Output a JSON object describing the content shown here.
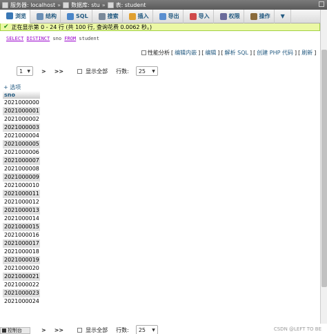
{
  "topbar": {
    "server": "服务器: localhost",
    "database": "数据库: stu",
    "table": "表: student"
  },
  "tabs": [
    {
      "label": "浏览",
      "icon": "browse-icon",
      "color": "#3a78b6"
    },
    {
      "label": "结构",
      "icon": "structure-icon",
      "color": "#6a8fb5"
    },
    {
      "label": "SQL",
      "icon": "sql-icon",
      "color": "#4a86c8"
    },
    {
      "label": "搜索",
      "icon": "search-icon",
      "color": "#7b8a9a"
    },
    {
      "label": "插入",
      "icon": "insert-icon",
      "color": "#e0a030"
    },
    {
      "label": "导出",
      "icon": "export-icon",
      "color": "#5b8fd0"
    },
    {
      "label": "导入",
      "icon": "import-icon",
      "color": "#d04a4a"
    },
    {
      "label": "权限",
      "icon": "privileges-icon",
      "color": "#6a6a9a"
    },
    {
      "label": "操作",
      "icon": "operations-icon",
      "color": "#8a6a3a"
    }
  ],
  "status": {
    "message": "正在显示第 0 - 24 行 (共 100 行, 查询花费 0.0062 秒。)"
  },
  "query": {
    "select": "SELECT",
    "distinct": "DISTINCT",
    "column": "sno",
    "from": "FROM",
    "table": "student"
  },
  "links": {
    "profiling": "性能分析",
    "inline_edit": "编辑内嵌",
    "edit": "编辑",
    "explain": "解析 SQL",
    "create_php": "创建 PHP 代码",
    "refresh": "刷新"
  },
  "pager": {
    "page": "1",
    "next": ">",
    "last": ">>",
    "show_all": "显示全部",
    "rows_label": "行数:",
    "rows": "25"
  },
  "options_label": "+ 选项",
  "table": {
    "header": "sno",
    "rows": [
      "2021000000",
      "2021000001",
      "2021000002",
      "2021000003",
      "2021000004",
      "2021000005",
      "2021000006",
      "2021000007",
      "2021000008",
      "2021000009",
      "2021000010",
      "2021000011",
      "2021000012",
      "2021000013",
      "2021000014",
      "2021000015",
      "2021000016",
      "2021000017",
      "2021000018",
      "2021000019",
      "2021000020",
      "2021000021",
      "2021000022",
      "2021000023",
      "2021000024"
    ]
  },
  "console": {
    "label": "控制台"
  },
  "watermark": "CSDN @LEFT TO BE"
}
